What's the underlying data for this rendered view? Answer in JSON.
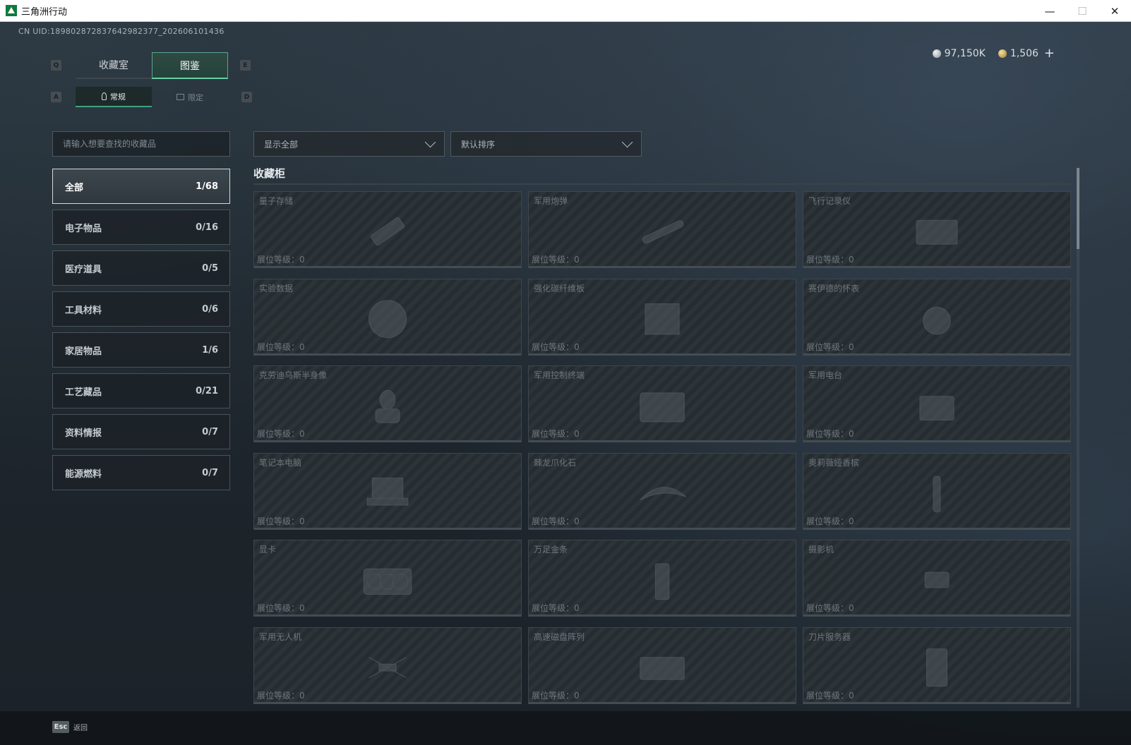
{
  "window": {
    "title": "三角洲行动",
    "minimize": "—",
    "maximize": "☐",
    "close": "✕"
  },
  "uid": "CN UID:1898028728376429823​77_202606101436",
  "currency": {
    "silver": "97,150K",
    "gold": "1,506",
    "plus": "+"
  },
  "keys": {
    "prev_tab": "Q",
    "next_tab": "E",
    "prev_sub": "A",
    "next_sub": "D"
  },
  "tabs": [
    "收藏室",
    "图鉴"
  ],
  "subtabs": [
    "常规",
    "限定"
  ],
  "search": {
    "placeholder": "请输入想要查找的收藏品"
  },
  "filters": {
    "display": "显示全部",
    "sort": "默认排序"
  },
  "categories": [
    {
      "label": "全部",
      "count": "1/68"
    },
    {
      "label": "电子物品",
      "count": "0/16"
    },
    {
      "label": "医疗道具",
      "count": "0/5"
    },
    {
      "label": "工具材料",
      "count": "0/6"
    },
    {
      "label": "家居物品",
      "count": "1/6"
    },
    {
      "label": "工艺藏品",
      "count": "0/21"
    },
    {
      "label": "资料情报",
      "count": "0/7"
    },
    {
      "label": "能源燃料",
      "count": "0/7"
    }
  ],
  "section_title": "收藏柜",
  "items": [
    {
      "name": "量子存储",
      "level": "展位等级：0",
      "icon": "usb-drive-icon"
    },
    {
      "name": "军用炮弹",
      "level": "展位等级：0",
      "icon": "artillery-shell-icon"
    },
    {
      "name": "飞行记录仪",
      "level": "展位等级：0",
      "icon": "flight-recorder-icon"
    },
    {
      "name": "实验数据",
      "level": "展位等级：0",
      "icon": "disc-icon"
    },
    {
      "name": "强化碳纤维板",
      "level": "展位等级：0",
      "icon": "carbon-plate-icon"
    },
    {
      "name": "赛伊德的怀表",
      "level": "展位等级：0",
      "icon": "pocket-watch-icon"
    },
    {
      "name": "克劳迪乌斯半身像",
      "level": "展位等级：0",
      "icon": "bust-icon"
    },
    {
      "name": "军用控制终端",
      "level": "展位等级：0",
      "icon": "control-terminal-icon"
    },
    {
      "name": "军用电台",
      "level": "展位等级：0",
      "icon": "radio-icon"
    },
    {
      "name": "笔记本电脑",
      "level": "展位等级：0",
      "icon": "laptop-icon"
    },
    {
      "name": "棘龙爪化石",
      "level": "展位等级：0",
      "icon": "claw-fossil-icon"
    },
    {
      "name": "奥莉薇娅香槟",
      "level": "展位等级：0",
      "icon": "champagne-icon"
    },
    {
      "name": "显卡",
      "level": "展位等级：0",
      "icon": "graphics-card-icon"
    },
    {
      "name": "万足金条",
      "level": "展位等级：0",
      "icon": "gold-bar-icon"
    },
    {
      "name": "摄影机",
      "level": "展位等级：0",
      "icon": "camera-icon"
    },
    {
      "name": "军用无人机",
      "level": "展位等级：0",
      "icon": "drone-icon"
    },
    {
      "name": "高速磁盘阵列",
      "level": "展位等级：0",
      "icon": "disk-array-icon"
    },
    {
      "name": "刀片服务器",
      "level": "展位等级：0",
      "icon": "blade-server-icon"
    }
  ],
  "footer": {
    "esc": "Esc",
    "back": "返回"
  }
}
